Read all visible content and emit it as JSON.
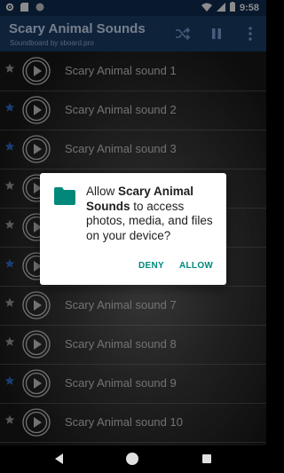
{
  "status_bar": {
    "time": "9:58",
    "left_icons": [
      "settings-icon",
      "sd-card-icon",
      "circle-icon"
    ],
    "right_icons": [
      "wifi-icon",
      "signal-icon",
      "battery-icon"
    ]
  },
  "app_bar": {
    "title": "Scary Animal Sounds",
    "subtitle": "Soundboard by sboard.pro",
    "actions": [
      "shuffle-icon",
      "pause-icon",
      "more-vert-icon"
    ]
  },
  "sounds": [
    {
      "label": "Scary Animal sound 1",
      "starred": false
    },
    {
      "label": "Scary Animal sound 2",
      "starred": true
    },
    {
      "label": "Scary Animal sound 3",
      "starred": true
    },
    {
      "label": "",
      "starred": false
    },
    {
      "label": "",
      "starred": false
    },
    {
      "label": "",
      "starred": true
    },
    {
      "label": "Scary Animal sound 7",
      "starred": false
    },
    {
      "label": "Scary Animal sound 8",
      "starred": false
    },
    {
      "label": "Scary Animal sound 9",
      "starred": true
    },
    {
      "label": "Scary Animal sound 10",
      "starred": false
    }
  ],
  "dialog": {
    "text_before": "Allow ",
    "app_name": "Scary Animal Sounds",
    "text_after": " to access photos, media, and files on your device?",
    "deny_label": "DENY",
    "allow_label": "ALLOW",
    "icon": "folder-icon"
  },
  "colors": {
    "app_bar": "#1a3e6a",
    "status_bar": "#0f2d52",
    "star_active": "#2f6fd6",
    "star_inactive": "#9e9e9e",
    "dialog_accent": "#00897b",
    "folder": "#00897b"
  },
  "nav_bar": [
    "back-icon",
    "home-icon",
    "recents-icon"
  ]
}
